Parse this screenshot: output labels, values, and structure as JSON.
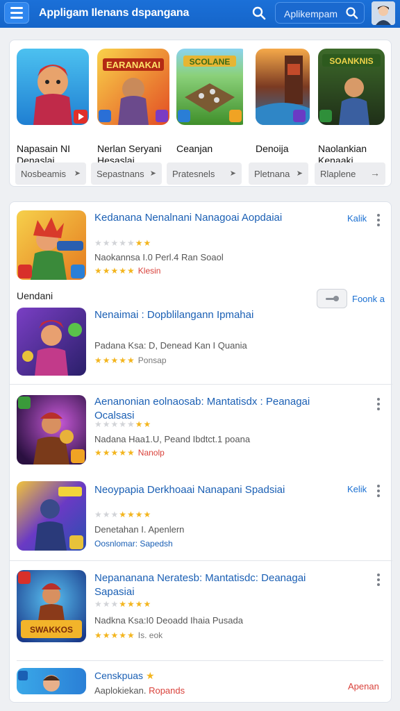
{
  "header": {
    "title": "Appligam Ilenans dspangana",
    "search_text": "Aplikempam",
    "colors": {
      "bar": "#1565c9",
      "accent": "#1a6fd1"
    }
  },
  "featured": [
    {
      "name": "Napasain NI Denaslai",
      "chip": "Nosbeamis"
    },
    {
      "name": "Nerlan Seryani Hesaslai",
      "chip": "Sepastnans"
    },
    {
      "name": "Ceanjan",
      "chip": "Pratesnels"
    },
    {
      "name": "Denoija",
      "chip": "Pletnana"
    },
    {
      "name": "Naolankian Kenaaki",
      "chip": "Rlaplene"
    }
  ],
  "list": {
    "items": [
      {
        "title": "Kedanana Nenalnani Nanagoai Aopdaiai",
        "meta": "Naokannsa I.0 Perl.4 Ran Soaol",
        "tag": "Klesin",
        "action": "Kalik"
      },
      {
        "title": "Nenaimai : Dopblilangann Ipmahai",
        "meta": "Padana Ksa: D, Denead Kan I Quania",
        "tag": "Ponsap",
        "action": ""
      },
      {
        "title": "Aenanonian eolnaosab: Mantatisdx : Peanagai Ocalsasi",
        "meta": "Nadana Haa1.U, Peand Ibdtct.1 poana",
        "tag": "Nanolp",
        "action": ""
      },
      {
        "title": "Neoypapia Derkhoaai Nanapani Spadsiai",
        "meta": "Denetahan I. Apenlern",
        "tag": "Oosnlomar: Sapedsh",
        "action": "Kelik"
      },
      {
        "title": "Nepananana Neratesb: Mantatisdc: Deanagai Sapasiai",
        "meta": "Nadkna Ksa:I0 Deoadd Ihaia Pusada",
        "tag": "Is. eok",
        "action": ""
      },
      {
        "title": "Censkpuas",
        "meta": "Aaplokiekan.",
        "tag": "Ropands",
        "action": "Apenan"
      }
    ],
    "section_label": "Uendani",
    "toggle_label": "Foonk a"
  }
}
